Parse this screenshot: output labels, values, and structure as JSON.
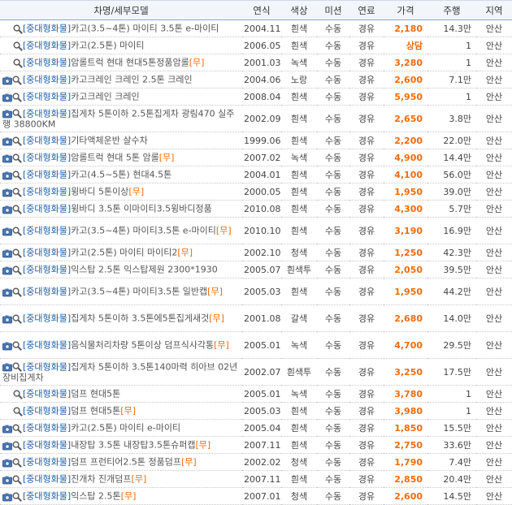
{
  "header": {
    "model": "차명/세부모델",
    "year": "연식",
    "color": "색상",
    "mission": "미션",
    "fuel": "연료",
    "price": "가격",
    "mileage": "주행",
    "region": "지역"
  },
  "icons": {
    "photo": "camera-icon",
    "search": "magnifier-icon"
  },
  "colors": {
    "price": "#f26b0d",
    "category": "#1f5fa8",
    "tag": "#f26b0d"
  },
  "rows": [
    {
      "photo": false,
      "cat": "[중대형화물]",
      "name": "카고(3.5~4톤) 마이티 3.5톤 e-마이티",
      "tag": "",
      "year": "2004.11",
      "color": "흰색",
      "mission": "수동",
      "fuel": "경유",
      "price": "2,180",
      "mileage": "14.3만",
      "region": "안산"
    },
    {
      "photo": false,
      "cat": "[중대형화물]",
      "name": "카고(2.5톤) 마이티",
      "tag": "",
      "year": "2006.05",
      "color": "흰색",
      "mission": "수동",
      "fuel": "경유",
      "price": "상담",
      "mileage": "1",
      "region": "안산"
    },
    {
      "photo": false,
      "cat": "[중대형화물]",
      "name": "암롤트럭 현대 현대5톤정품암롤",
      "tag": "[무]",
      "year": "2001.03",
      "color": "녹색",
      "mission": "수동",
      "fuel": "경유",
      "price": "3,280",
      "mileage": "1",
      "region": "안산"
    },
    {
      "photo": true,
      "cat": "[중대형화물]",
      "name": "카고크레인 크레인 2.5톤 크레인",
      "tag": "",
      "year": "2004.06",
      "color": "노랑",
      "mission": "수동",
      "fuel": "경유",
      "price": "2,600",
      "mileage": "7.1만",
      "region": "안산"
    },
    {
      "photo": true,
      "cat": "[중대형화물]",
      "name": "카고크레인 크레인",
      "tag": "",
      "year": "2008.04",
      "color": "흰색",
      "mission": "수동",
      "fuel": "경유",
      "price": "5,950",
      "mileage": "1",
      "region": "안산"
    },
    {
      "photo": true,
      "cat": "[중대형화물]",
      "name": "집게차 5톤이하 2.5톤집게차 광림470 실주행 38800KM",
      "tag": "",
      "year": "2002.09",
      "color": "흰색",
      "mission": "수동",
      "fuel": "경유",
      "price": "2,650",
      "mileage": "3.8만",
      "region": "안산"
    },
    {
      "photo": true,
      "cat": "[중대형화물]",
      "name": "기타액체운반 살수차",
      "tag": "",
      "year": "1999.06",
      "color": "흰색",
      "mission": "수동",
      "fuel": "경유",
      "price": "2,200",
      "mileage": "22.0만",
      "region": "안산"
    },
    {
      "photo": true,
      "cat": "[중대형화물]",
      "name": "암롤트럭 현대 5톤 암롤",
      "tag": "[무]",
      "year": "2007.02",
      "color": "녹색",
      "mission": "수동",
      "fuel": "경유",
      "price": "4,900",
      "mileage": "14.4만",
      "region": "안산"
    },
    {
      "photo": true,
      "cat": "[중대형화물]",
      "name": "카고(4.5~5톤) 현대4.5톤",
      "tag": "",
      "year": "2004.01",
      "color": "흰색",
      "mission": "수동",
      "fuel": "경유",
      "price": "4,100",
      "mileage": "56.0만",
      "region": "안산"
    },
    {
      "photo": true,
      "cat": "[중대형화물]",
      "name": "윙바디 5톤이상",
      "tag": "[무]",
      "year": "2000.05",
      "color": "흰색",
      "mission": "수동",
      "fuel": "경유",
      "price": "1,950",
      "mileage": "39.0만",
      "region": "안산"
    },
    {
      "photo": true,
      "cat": "[중대형화물]",
      "name": "윙바디 3.5톤 이마이티3.5윙바디정품",
      "tag": "",
      "year": "2010.08",
      "color": "흰색",
      "mission": "수동",
      "fuel": "경유",
      "price": "4,300",
      "mileage": "5.7만",
      "region": "안산"
    },
    {
      "photo": true,
      "cat": "[중대형화물]",
      "name": "카고(3.5~4톤) 마이티3.5톤 e-마이티",
      "tag": "[무]",
      "year": "2010.10",
      "color": "흰색",
      "mission": "수동",
      "fuel": "경유",
      "price": "3,190",
      "mileage": "16.9만",
      "region": "안산"
    },
    {
      "photo": true,
      "cat": "[중대형화물]",
      "name": "카고(2.5톤) 마이티 마이티2",
      "tag": "[무]",
      "year": "2002.10",
      "color": "청색",
      "mission": "수동",
      "fuel": "경유",
      "price": "1,250",
      "mileage": "42.3만",
      "region": "안산"
    },
    {
      "photo": true,
      "cat": "[중대형화물]",
      "name": "익스탑 2.5톤 익스탑제원 2300*1930",
      "tag": "",
      "year": "2005.07",
      "color": "흰색투",
      "mission": "수동",
      "fuel": "경유",
      "price": "2,050",
      "mileage": "39.5만",
      "region": "안산"
    },
    {
      "photo": true,
      "cat": "[중대형화물]",
      "name": "카고(3.5~4톤) 마이티3.5톤 일반캡",
      "tag": "[무]",
      "year": "2005.03",
      "color": "흰색",
      "mission": "수동",
      "fuel": "경유",
      "price": "1,950",
      "mileage": "44.2만",
      "region": "안산"
    },
    {
      "photo": true,
      "cat": "[중대형화물]",
      "name": "집게차 5톤이하 3.5톤에5톤집게새것",
      "tag": "[무]",
      "year": "2001.08",
      "color": "갈색",
      "mission": "수동",
      "fuel": "경유",
      "price": "2,680",
      "mileage": "14.0만",
      "region": "안산"
    },
    {
      "photo": true,
      "cat": "[중대형화물]",
      "name": "음식물처리차량 5톤이상 덤프식사각통",
      "tag": "[무]",
      "year": "2005.01",
      "color": "녹색",
      "mission": "수동",
      "fuel": "경유",
      "price": "4,700",
      "mileage": "29.5만",
      "region": "안산"
    },
    {
      "photo": true,
      "cat": "[중대형화물]",
      "name": "집게차 5톤이하 3.5톤140마력 히아브 02년장비집게차",
      "tag": "",
      "year": "2002.07",
      "color": "흰색투",
      "mission": "수동",
      "fuel": "경유",
      "price": "3,250",
      "mileage": "17.5만",
      "region": "안산"
    },
    {
      "photo": false,
      "cat": "[중대형화물]",
      "name": "덤프 현대5톤",
      "tag": "",
      "year": "2005.01",
      "color": "녹색",
      "mission": "수동",
      "fuel": "경유",
      "price": "3,780",
      "mileage": "1",
      "region": "안산"
    },
    {
      "photo": false,
      "cat": "[중대형화물]",
      "name": "덤프 현대5톤",
      "tag": "[무]",
      "year": "2005.03",
      "color": "흰색",
      "mission": "수동",
      "fuel": "경유",
      "price": "3,980",
      "mileage": "1",
      "region": "안산"
    },
    {
      "photo": true,
      "cat": "[중대형화물]",
      "name": "카고(2.5톤) 마이티 e-마이티",
      "tag": "",
      "year": "2005.04",
      "color": "흰색",
      "mission": "수동",
      "fuel": "경유",
      "price": "1,850",
      "mileage": "15.5만",
      "region": "안산"
    },
    {
      "photo": true,
      "cat": "[중대형화물]",
      "name": "내장탑 3.5톤 내장탑3.5톤슈퍼캡",
      "tag": "[무]",
      "year": "2007.11",
      "color": "흰색",
      "mission": "수동",
      "fuel": "경유",
      "price": "2,750",
      "mileage": "33.6만",
      "region": "안산"
    },
    {
      "photo": true,
      "cat": "[중대형화물]",
      "name": "덤프 프런티어2.5톤 정품덤프",
      "tag": "[무]",
      "year": "2002.02",
      "color": "청색",
      "mission": "수동",
      "fuel": "경유",
      "price": "1,790",
      "mileage": "7.4만",
      "region": "안산"
    },
    {
      "photo": true,
      "cat": "[중대형화물]",
      "name": "진개차 진개덤프",
      "tag": "[무]",
      "year": "2007.11",
      "color": "흰색",
      "mission": "수동",
      "fuel": "경유",
      "price": "2,850",
      "mileage": "20.4만",
      "region": "안산"
    },
    {
      "photo": true,
      "cat": "[중대형화물]",
      "name": "익스탑 2.5톤",
      "tag": "[무]",
      "year": "2007.01",
      "color": "청색",
      "mission": "수동",
      "fuel": "경유",
      "price": "2,600",
      "mileage": "14.5만",
      "region": "안산"
    }
  ]
}
